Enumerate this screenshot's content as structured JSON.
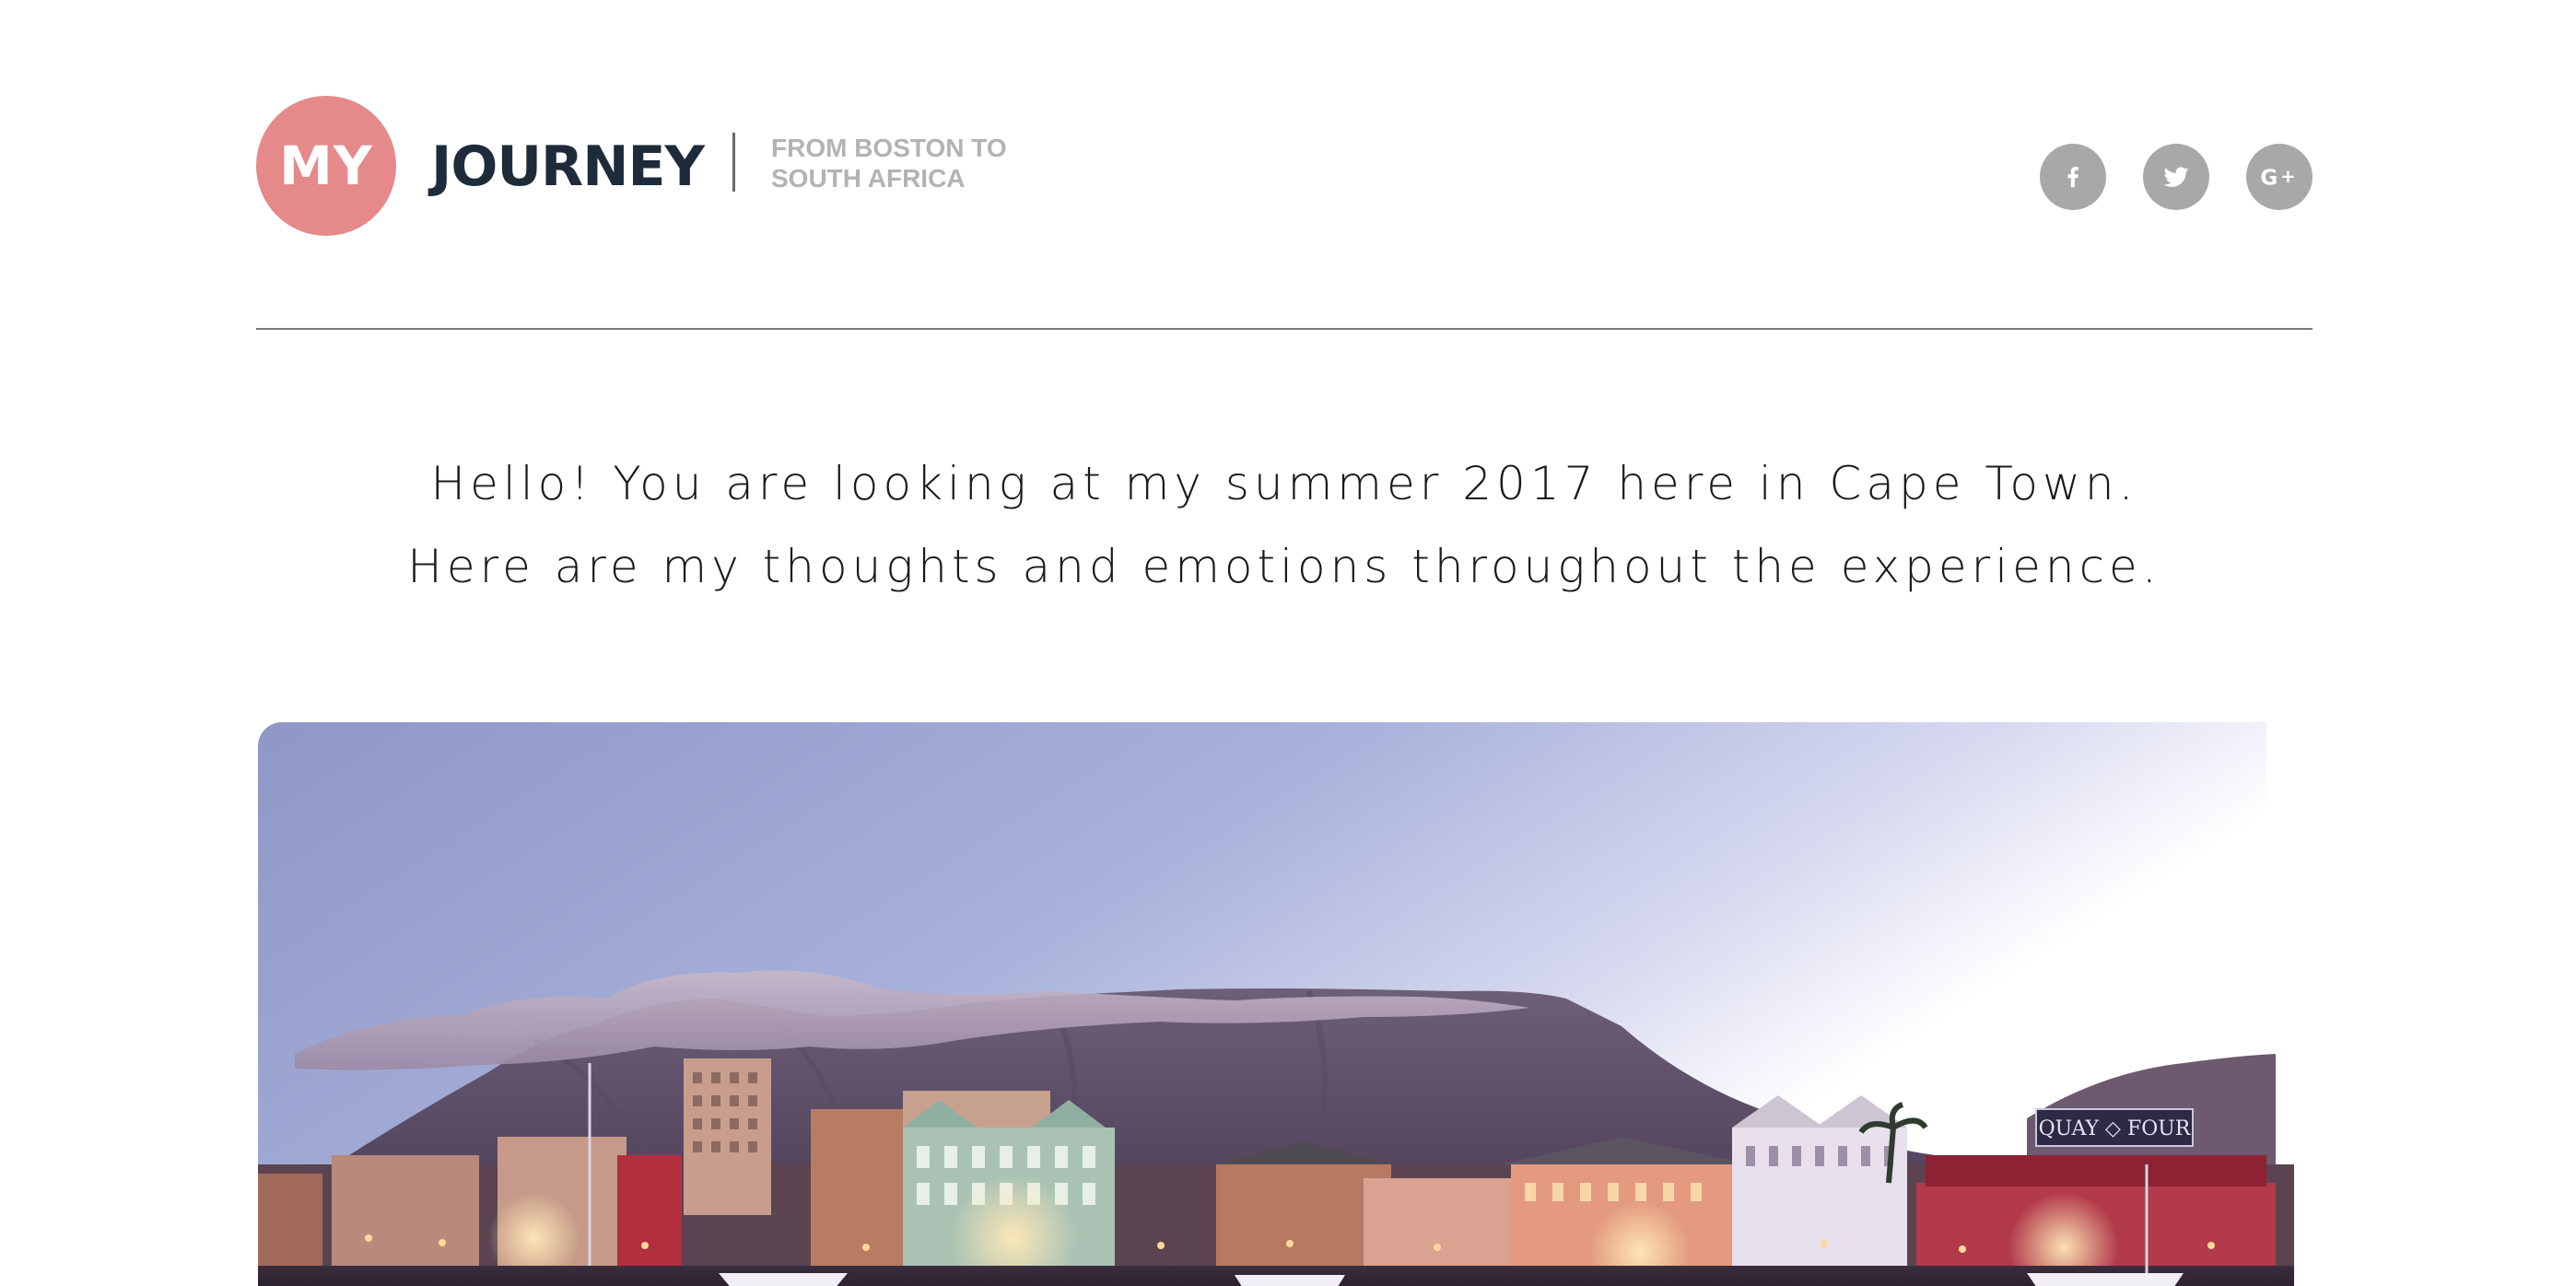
{
  "header": {
    "logo_badge": "MY",
    "logo_title": "JOURNEY",
    "tagline_line1": "FROM BOSTON TO",
    "tagline_line2": "SOUTH AFRICA",
    "brand_color": "#e5898a",
    "title_color": "#1d2b3a"
  },
  "social": {
    "icons": [
      "facebook-icon",
      "twitter-icon",
      "google-plus-icon"
    ],
    "color": "#a8a8a8"
  },
  "intro": {
    "line1": "Hello! You are looking at my summer 2017 here in Cape Town.",
    "line2": "Here are my thoughts and emotions throughout the experience."
  },
  "hero": {
    "scene": "photo",
    "sign_text": "QUAY ◇ FOUR"
  }
}
